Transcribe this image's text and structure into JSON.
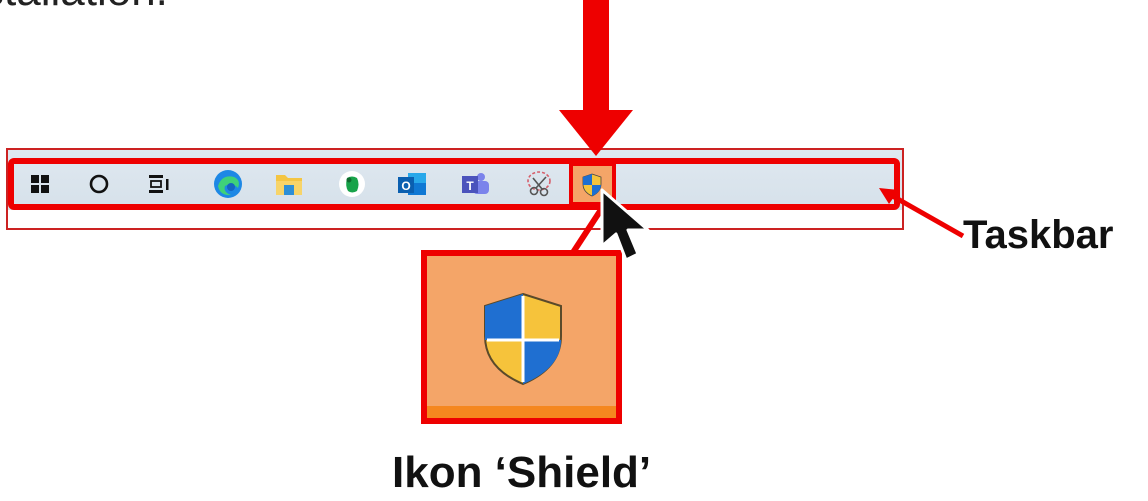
{
  "header": {
    "partial_text": "stallation."
  },
  "taskbar": {
    "icons": [
      {
        "name": "windows-start-icon"
      },
      {
        "name": "cortana-search-icon"
      },
      {
        "name": "task-view-icon"
      },
      {
        "name": "edge-icon"
      },
      {
        "name": "file-explorer-icon"
      },
      {
        "name": "evernote-icon"
      },
      {
        "name": "outlook-icon"
      },
      {
        "name": "teams-icon"
      },
      {
        "name": "snipping-tool-icon"
      },
      {
        "name": "uac-shield-icon"
      }
    ]
  },
  "labels": {
    "taskbar": "Taskbar",
    "shield": "Ikon ‘Shield’"
  },
  "colors": {
    "highlight": "#e00000",
    "shield_bg": "#f4a568",
    "taskbar_bg": "#d6e1ea",
    "shield_blue": "#1f6fd1",
    "shield_yellow": "#f6c33b"
  }
}
